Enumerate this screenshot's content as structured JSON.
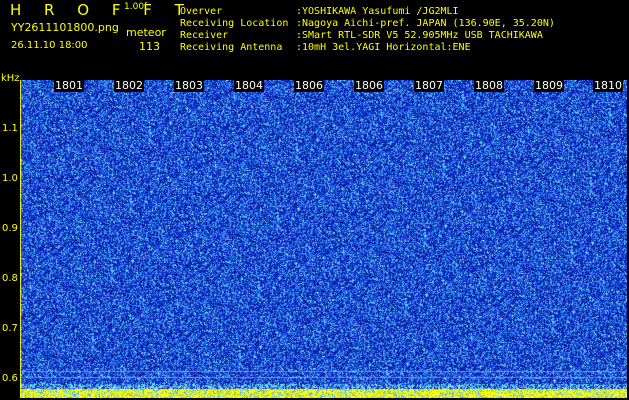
{
  "header": {
    "title": "H R O F F T",
    "version": "1.00f",
    "filename": "YY2611101800.png",
    "mode": "meteor",
    "datetime": "26.11.10 18:00",
    "count": "113"
  },
  "info": {
    "labels": [
      "Overver",
      "Receiving Location",
      "Receiver",
      "Receiving Antenna"
    ],
    "values": [
      ":YOSHIKAWA Yasufumi /JG2MLI",
      ":Nagoya Aichi-pref. JAPAN (136.90E, 35.20N)",
      ":SMart RTL-SDR V5 52.905MHz USB TACHIKAWA",
      ":10mH 3el.YAGI Horizontal:ENE"
    ]
  },
  "spectrogram": {
    "y_unit": "kHz",
    "y_ticks": [
      "1.1",
      "1.0",
      "0.9",
      "0.8",
      "0.7",
      "0.6"
    ],
    "x_ticks": [
      "1801",
      "1802",
      "1803",
      "1804",
      "1806",
      "1806",
      "1807",
      "1808",
      "1809",
      "1810"
    ],
    "colors": {
      "background": "#1020c0",
      "noise_dark": "#0818a0",
      "noise_light": "#3ab0ff",
      "noise_cyan": "#7ff0ff",
      "floor": "#ffff00"
    }
  }
}
